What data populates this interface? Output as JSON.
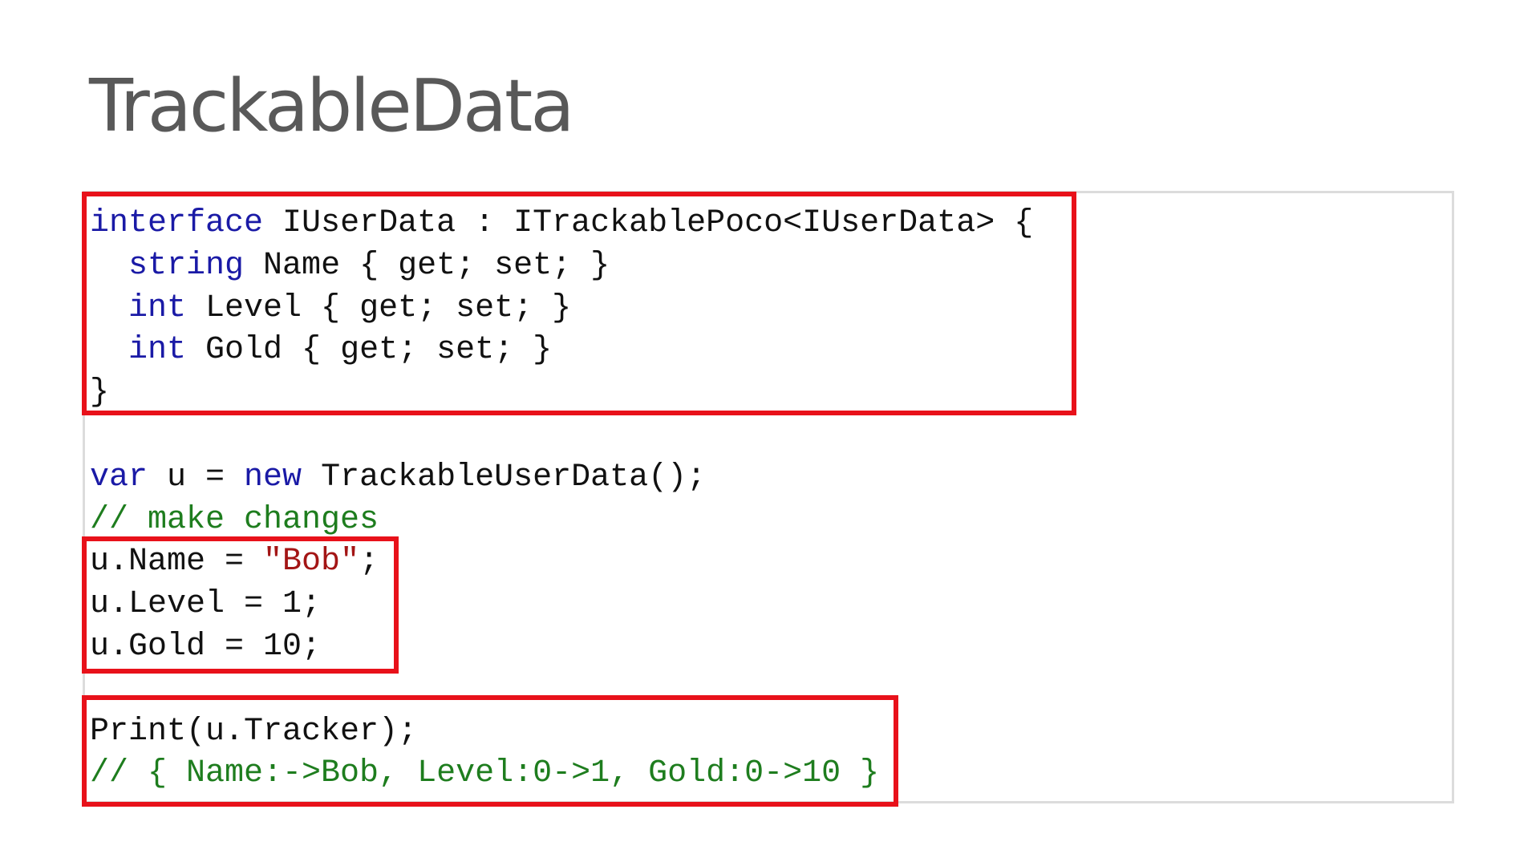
{
  "slide": {
    "title": "TrackableData"
  },
  "code": {
    "interface_block": {
      "line1": {
        "keyword": "interface",
        "rest": " IUserData : ITrackablePoco<IUserData> {"
      },
      "line2": {
        "indent": "  ",
        "keyword": "string",
        "rest": " Name { get; set; }"
      },
      "line3": {
        "indent": "  ",
        "keyword": "int",
        "rest": " Level { get; set; }"
      },
      "line4": {
        "indent": "  ",
        "keyword": "int",
        "rest": " Gold { get; set; }"
      },
      "line5": "}"
    },
    "create_line": {
      "kw1": "var",
      "mid": " u = ",
      "kw2": "new",
      "rest": " TrackableUserData();"
    },
    "comment_make_changes": "// make changes",
    "assignments": {
      "name": {
        "prefix": "u.Name = ",
        "string": "\"Bob\"",
        "suffix": ";"
      },
      "level": "u.Level = 1;",
      "gold": "u.Gold = 10;"
    },
    "print_block": {
      "print": "Print(u.Tracker);",
      "output_comment": "// { Name:->Bob, Level:0->1, Gold:0->10 }"
    }
  },
  "colors": {
    "keyword": "#1a1aa6",
    "comment": "#1e7d1e",
    "string": "#a31515",
    "highlight_border": "#e8111a",
    "panel_border": "#dcdcdc",
    "title": "#595959"
  }
}
